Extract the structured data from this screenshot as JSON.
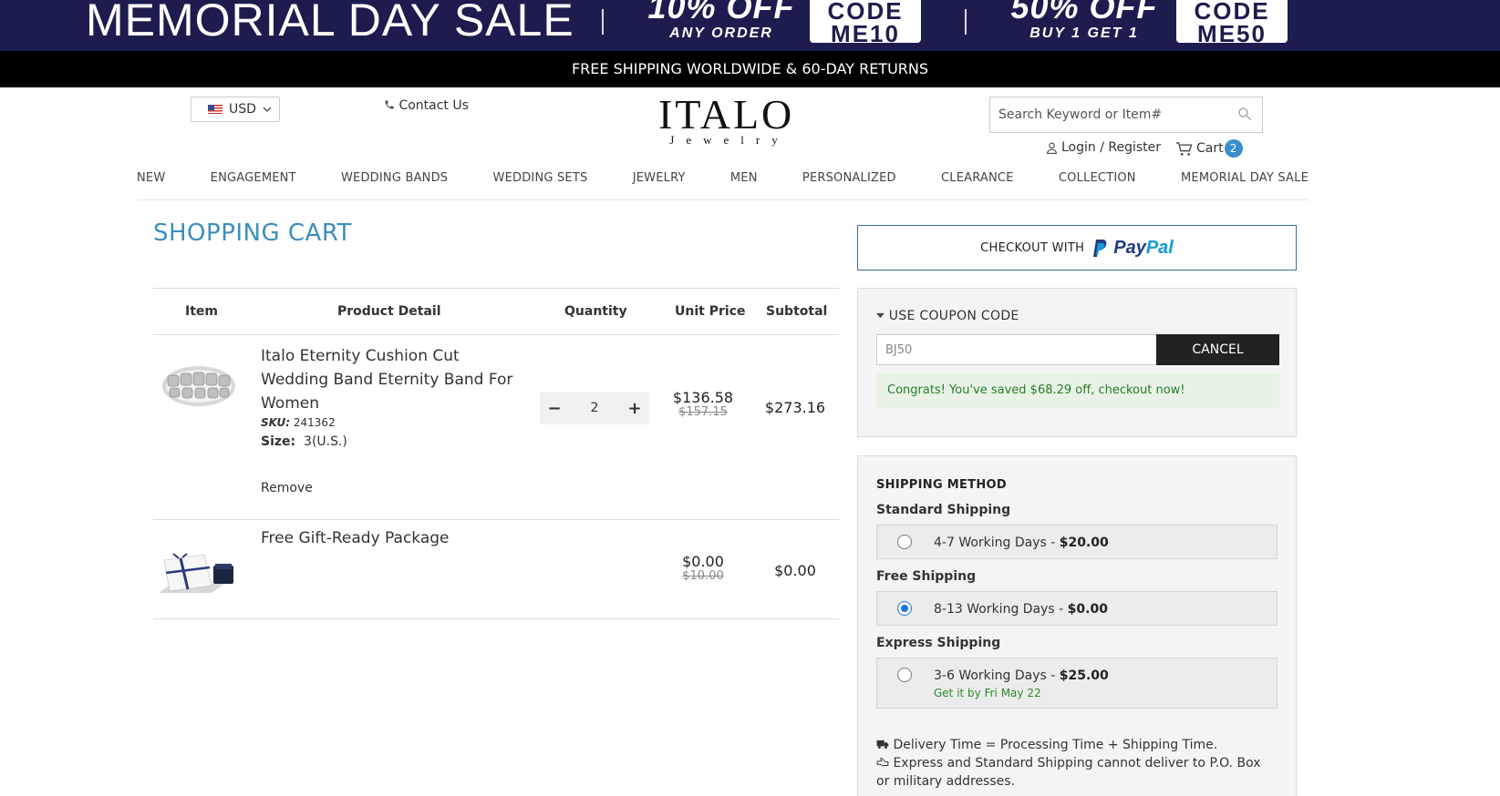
{
  "banner": {
    "title": "MEMORIAL DAY SALE",
    "offer1_big": "10% OFF",
    "offer1_small": "ANY ORDER",
    "code1_label": "CODE",
    "code1_value": "ME10",
    "offer2_big": "50% OFF",
    "offer2_small": "BUY 1 GET 1",
    "code2_label": "CODE",
    "code2_value": "ME50"
  },
  "shipbar": {
    "text": "FREE SHIPPING WORLDWIDE & 60-DAY RETURNS"
  },
  "header": {
    "currency": "USD",
    "contact": "Contact Us",
    "logo_main": "ITALO",
    "logo_sub": "Jewelry",
    "search_placeholder": "Search Keyword or Item#",
    "login": "Login / Register",
    "cart_label": "Cart",
    "cart_count": "2"
  },
  "nav": [
    "NEW",
    "ENGAGEMENT",
    "WEDDING BANDS",
    "WEDDING SETS",
    "JEWELRY",
    "MEN",
    "PERSONALIZED",
    "CLEARANCE",
    "COLLECTION",
    "MEMORIAL DAY SALE"
  ],
  "cart": {
    "title": "SHOPPING CART",
    "columns": {
      "item": "Item",
      "detail": "Product Detail",
      "quantity": "Quantity",
      "unit_price": "Unit Price",
      "subtotal": "Subtotal"
    },
    "items": [
      {
        "name": "Italo Eternity Cushion Cut Wedding Band Eternity Band For Women",
        "sku_label": "SKU:",
        "sku": "241362",
        "size_label": "Size:",
        "size": "3(U.S.)",
        "quantity": "2",
        "price": "$136.58",
        "old_price": "$157.15",
        "subtotal": "$273.16",
        "remove": "Remove"
      },
      {
        "name": "Free Gift-Ready Package",
        "price": "$0.00",
        "old_price": "$10.00",
        "subtotal": "$0.00"
      }
    ]
  },
  "checkout": {
    "paypal_label": "CHECKOUT WITH",
    "paypal_word1": "Pay",
    "paypal_word2": "Pal"
  },
  "coupon": {
    "heading": "USE COUPON CODE",
    "value": "BJ50",
    "cancel": "CANCEL",
    "message": "Congrats! You've saved $68.29 off, checkout now!"
  },
  "shipping": {
    "title": "SHIPPING METHOD",
    "options": [
      {
        "group": "Standard Shipping",
        "days": "4-7 Working Days - ",
        "price": "$20.00",
        "selected": false
      },
      {
        "group": "Free Shipping",
        "days": "8-13 Working Days - ",
        "price": "$0.00",
        "selected": true
      },
      {
        "group": "Express Shipping",
        "days": "3-6 Working Days - ",
        "price": "$25.00",
        "eta": "Get it by Fri May 22",
        "selected": false
      }
    ],
    "note1": "Delivery Time = Processing Time + Shipping Time.",
    "note2": "Express and Standard Shipping cannot deliver to P.O. Box or military addresses."
  },
  "colors": {
    "banner_bg": "#1c1d4e",
    "accent_blue": "#3a8ebf",
    "success_green": "#2a7a2a"
  }
}
